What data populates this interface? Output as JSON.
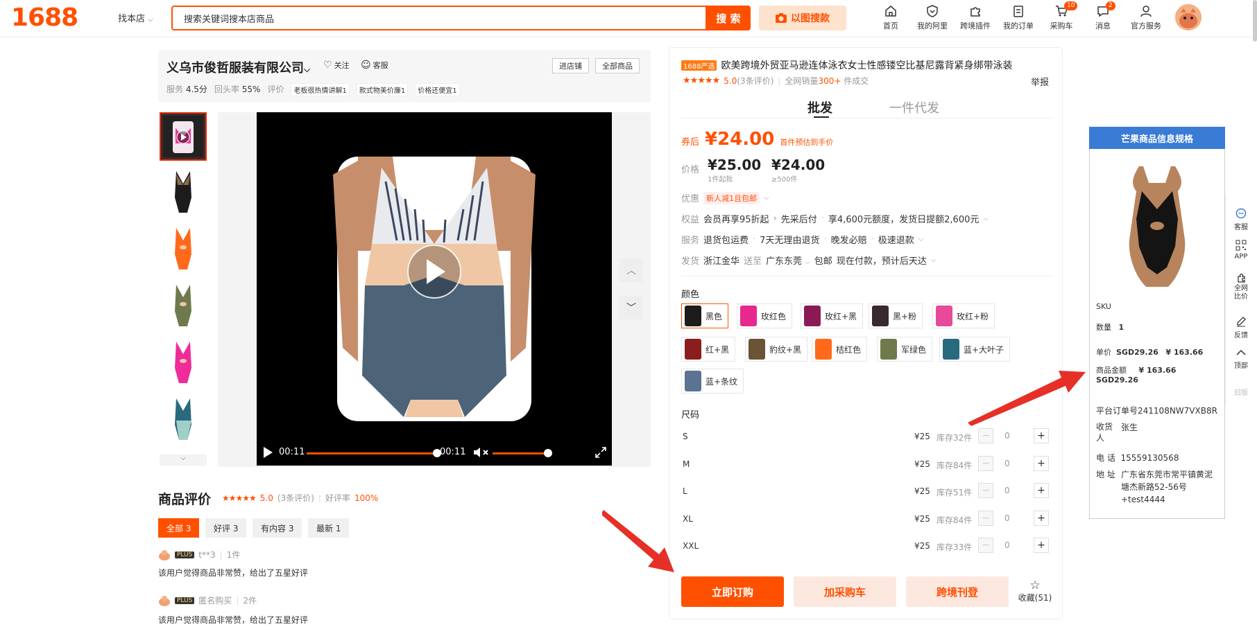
{
  "header": {
    "logo": "1688",
    "find_shop": "找本店",
    "search_value": "搜索关键词搜本店商品",
    "search_button": "搜 索",
    "image_search": "以图搜款",
    "nav": [
      {
        "label": "首页",
        "icon": "home-icon"
      },
      {
        "label": "我的阿里",
        "icon": "heart-shield-icon"
      },
      {
        "label": "跨境插件",
        "icon": "puzzle-icon"
      },
      {
        "label": "我的订单",
        "icon": "order-icon"
      },
      {
        "label": "采购车",
        "icon": "cart-icon",
        "badge": "10"
      },
      {
        "label": "消息",
        "icon": "message-icon",
        "badge": "2"
      },
      {
        "label": "官方服务",
        "icon": "user-icon"
      }
    ]
  },
  "shop": {
    "name": "义乌市俊哲服装有限公司",
    "follow": "关注",
    "service": "客服",
    "enter_shop": "进店铺",
    "all_products": "全部商品",
    "stats": {
      "service_label": "服务",
      "service_value": "4.5分",
      "repeat_label": "回头率",
      "repeat_value": "55%",
      "review_label": "评价",
      "tags": [
        "老板很热情讲解1",
        "款式物美价廉1",
        "价格还便宜1"
      ]
    }
  },
  "video": {
    "current_time": "00:11",
    "duration": "00:11",
    "progress": 1.0,
    "volume": 1.0
  },
  "reviews": {
    "title": "商品评价",
    "rating": "5.0",
    "count_text": "(3条评价)",
    "good_rate_label": "好评率",
    "good_rate": "100%",
    "tabs": [
      "全部 3",
      "好评 3",
      "有内容 3",
      "最新 1"
    ],
    "items": [
      {
        "user": "t**3",
        "qty": "1件",
        "plus": "PLUS",
        "text": "该用户觉得商品非常赞，给出了五星好评"
      },
      {
        "user": "匿名购买",
        "qty": "2件",
        "plus": "PLUS",
        "text": "该用户觉得商品非常赞，给出了五星好评"
      }
    ]
  },
  "product": {
    "badge": "1688严选",
    "title": "欧美跨境外贸亚马逊连体泳衣女士性感镂空比基尼露背紧身绑带泳装",
    "rating": "5.0",
    "rating_count": "(3条评价)",
    "sales_text": "全网销量",
    "sales_value": "300+",
    "sales_suffix": "件成交",
    "report": "举报",
    "tab_wholesale": "批发",
    "tab_dropship": "一件代发",
    "coupon_label": "券后",
    "coupon_price": "¥24.00",
    "coupon_note": "首件预估到手价",
    "price_label": "价格",
    "tiers": [
      {
        "price": "¥25.00",
        "sub": "1件起批"
      },
      {
        "price": "¥24.00",
        "sub": "≥500件"
      }
    ],
    "promo_label": "优惠",
    "promo_tag": "新人减1且包邮",
    "benefit_label": "权益",
    "benefit_items": [
      "会员再享95折起",
      "先采后付",
      "享4,600元额度，发货日提额2,600元"
    ],
    "service_label": "服务",
    "service_items": [
      "退货包运费",
      "7天无理由退货",
      "晚发必赔",
      "极速退款"
    ],
    "ship_label": "发货",
    "ship_from": "浙江金华",
    "ship_to_label": "送至",
    "ship_to": "广东东莞",
    "ship_free": "包邮",
    "ship_time": "现在付款，预计后天达",
    "color_label": "颜色",
    "colors": [
      {
        "name": "黑色",
        "swatch": "#1c1c1c"
      },
      {
        "name": "玫红色",
        "swatch": "#e8278f"
      },
      {
        "name": "玫红+黑",
        "swatch": "#8a1a55"
      },
      {
        "name": "黑+粉",
        "swatch": "#3a2a30"
      },
      {
        "name": "玫红+粉",
        "swatch": "#e84a9a"
      },
      {
        "name": "红+黑",
        "swatch": "#8a1e1e"
      },
      {
        "name": "豹纹+黑",
        "swatch": "#6b5338"
      },
      {
        "name": "桔红色",
        "swatch": "#ff6a1a"
      },
      {
        "name": "军绿色",
        "swatch": "#6e7a4c"
      },
      {
        "name": "蓝+大叶子",
        "swatch": "#2a6a7e"
      },
      {
        "name": "蓝+条纹",
        "swatch": "#5a7390"
      }
    ],
    "size_label": "尺码",
    "sizes": [
      {
        "name": "S",
        "price": "¥25",
        "stock": "库存32件",
        "qty": "0"
      },
      {
        "name": "M",
        "price": "¥25",
        "stock": "库存84件",
        "qty": "0"
      },
      {
        "name": "L",
        "price": "¥25",
        "stock": "库存51件",
        "qty": "0"
      },
      {
        "name": "XL",
        "price": "¥25",
        "stock": "库存84件",
        "qty": "0"
      },
      {
        "name": "XXL",
        "price": "¥25",
        "stock": "库存33件",
        "qty": "0"
      }
    ],
    "buy_now": "立即订购",
    "add_cart": "加采购车",
    "cross_list": "跨境刊登",
    "favorite": "收藏(51)"
  },
  "info_card": {
    "title": "芒果商品信息规格",
    "sku_label": "SKU",
    "qty_label": "数量",
    "qty_value": "1",
    "unit_label": "单价",
    "unit_sgd": "SGD29.26",
    "unit_cny": "¥ 163.66",
    "amount_label": "商品金额",
    "amount_cny": "¥ 163.66",
    "amount_sgd": "SGD29.26",
    "order_label": "平台订单号",
    "order_no": "241108NW7VXB8R",
    "receiver_label": "收货人",
    "receiver": "张生",
    "phone_label": "电 话",
    "phone": "15559130568",
    "addr_label": "地 址",
    "addr": [
      "广东省东莞市常平镇黄泥",
      "塘杰新路52-56号",
      "+test4444"
    ]
  },
  "sidebar": [
    {
      "label": "客服",
      "icon": "chat-icon"
    },
    {
      "label": "APP",
      "icon": "qr-icon"
    },
    {
      "label": "全网比价",
      "icon": "compare-icon"
    },
    {
      "label": "反馈",
      "icon": "feedback-icon"
    },
    {
      "label": "顶部",
      "icon": "top-icon"
    },
    {
      "label": "旧版",
      "icon": ""
    }
  ],
  "colors": {
    "brand": "#ff5000",
    "card_head": "#3a7bd5"
  }
}
